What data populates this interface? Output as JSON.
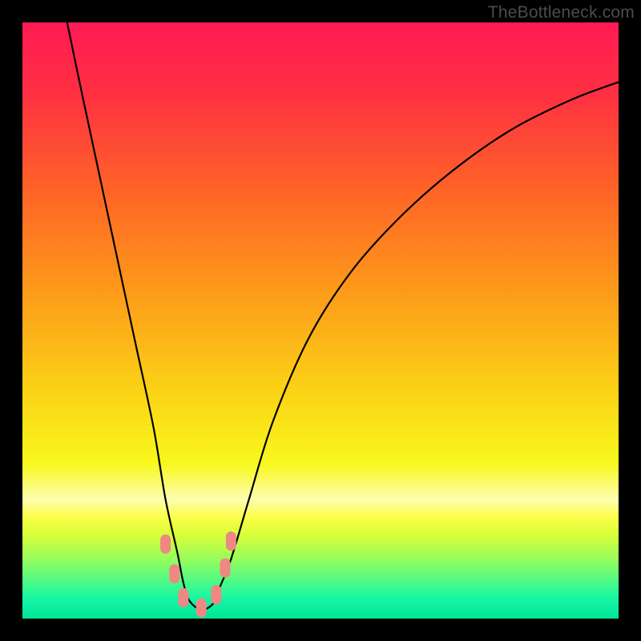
{
  "watermark": "TheBottleneck.com",
  "colors": {
    "background": "#000000",
    "curve": "#000000",
    "markers": "#ef8783",
    "watermark_text": "#4c4c4c",
    "gradient_stops": [
      {
        "offset": 0.0,
        "color": "#ff1a54"
      },
      {
        "offset": 0.12,
        "color": "#ff3042"
      },
      {
        "offset": 0.28,
        "color": "#fe6327"
      },
      {
        "offset": 0.45,
        "color": "#fd9a1a"
      },
      {
        "offset": 0.62,
        "color": "#fbd316"
      },
      {
        "offset": 0.74,
        "color": "#f8f81c"
      },
      {
        "offset": 0.8,
        "color": "#fdfeb0"
      },
      {
        "offset": 0.83,
        "color": "#fbfe48"
      },
      {
        "offset": 0.86,
        "color": "#d8fe3a"
      },
      {
        "offset": 0.9,
        "color": "#97fd5c"
      },
      {
        "offset": 0.94,
        "color": "#4afa88"
      },
      {
        "offset": 0.965,
        "color": "#17f7a5"
      },
      {
        "offset": 1.0,
        "color": "#00e596"
      }
    ]
  },
  "chart_data": {
    "type": "line",
    "title": "",
    "xlabel": "",
    "ylabel": "",
    "xlim": [
      0,
      100
    ],
    "ylim": [
      0,
      100
    ],
    "note": "Bottleneck-style V-shaped curve. x is relative horizontal position (0–100), y is relative vertical distance from bottom (0=bottom green band, 100=top red). Minimum (best match / no bottleneck) occurs near x≈27–32.",
    "series": [
      {
        "name": "bottleneck-curve",
        "x": [
          7.5,
          10,
          13,
          16,
          19,
          22,
          24,
          26,
          27,
          28,
          30,
          32,
          33,
          35,
          38,
          42,
          48,
          55,
          63,
          72,
          82,
          92,
          100
        ],
        "y": [
          100,
          88,
          74,
          60,
          46,
          32,
          20,
          11,
          6,
          3,
          1.5,
          2.5,
          5,
          10,
          20,
          33,
          47,
          58,
          67,
          75,
          82,
          87,
          90
        ]
      }
    ],
    "markers": {
      "name": "highlight-points",
      "description": "Salmon rounded markers near the curve's valley",
      "points": [
        {
          "x": 24.0,
          "y": 12.5
        },
        {
          "x": 25.5,
          "y": 7.5
        },
        {
          "x": 27.0,
          "y": 3.5
        },
        {
          "x": 30.0,
          "y": 1.8
        },
        {
          "x": 32.5,
          "y": 4.0
        },
        {
          "x": 34.0,
          "y": 8.5
        },
        {
          "x": 35.0,
          "y": 13.0
        }
      ]
    }
  }
}
